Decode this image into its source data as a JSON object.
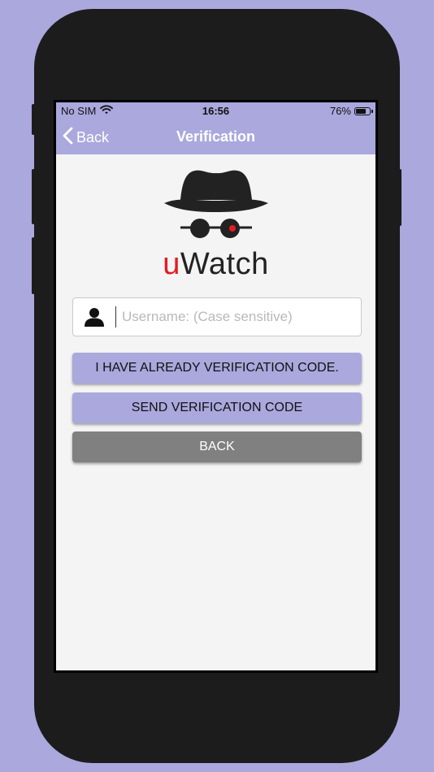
{
  "status_bar": {
    "carrier": "No SIM",
    "time": "16:56",
    "battery": "76%",
    "battery_level": 0.76
  },
  "nav": {
    "back_label": "Back",
    "title": "Verification"
  },
  "logo": {
    "brand_accent": "u",
    "brand_rest": "Watch"
  },
  "username_field": {
    "placeholder": "Username: (Case sensitive)",
    "value": ""
  },
  "buttons": {
    "have_code": "I HAVE ALREADY VERIFICATION CODE.",
    "send_code": "SEND VERIFICATION CODE",
    "back": "BACK"
  },
  "icons": {
    "wifi": "wifi-icon",
    "back": "chevron-left-icon",
    "user": "user-icon",
    "logo": "spy-hat-glasses-icon"
  },
  "colors": {
    "accent": "#aaa8dd",
    "brand_red": "#e31b23",
    "gray_button": "#808080",
    "background": "#f4f4f4"
  }
}
